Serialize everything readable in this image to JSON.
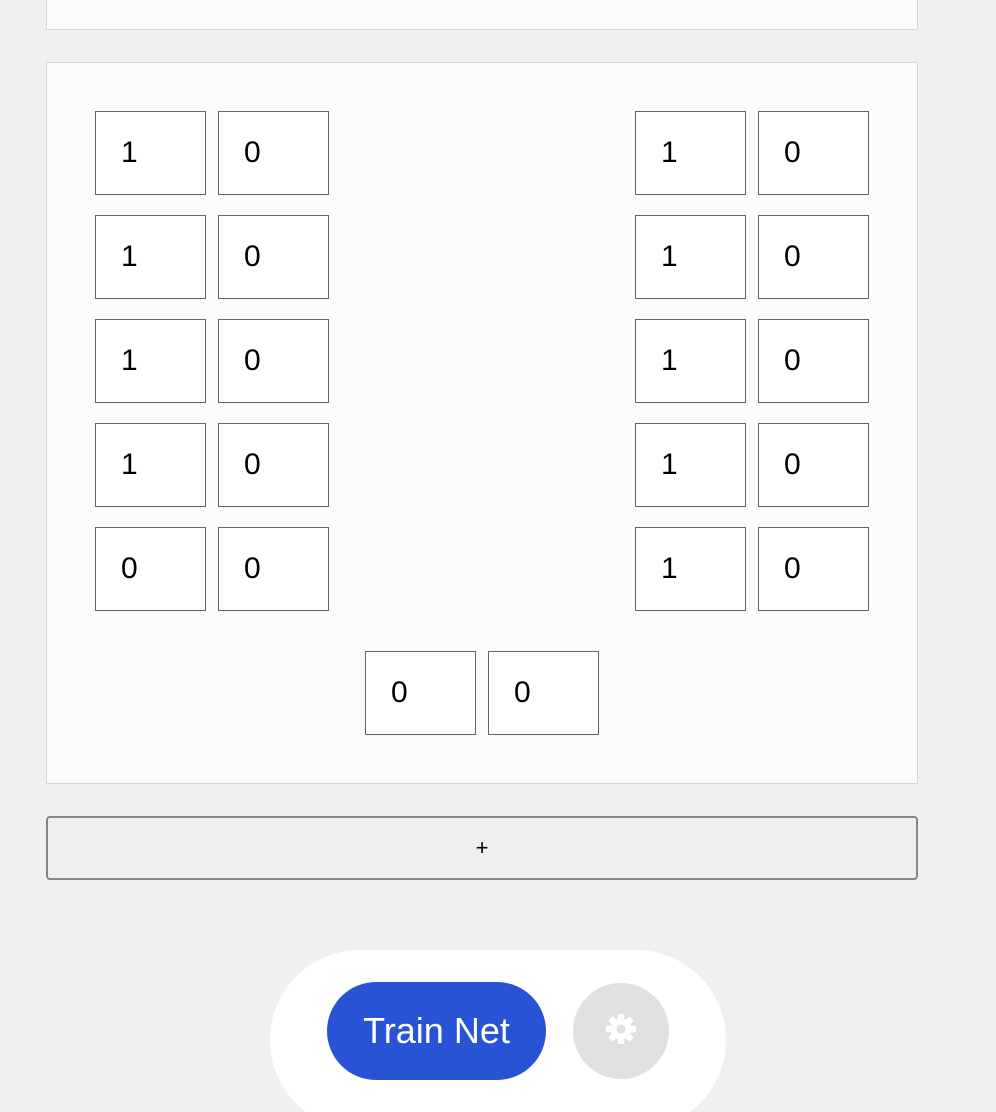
{
  "grid": {
    "left_column": [
      [
        "1",
        "0"
      ],
      [
        "1",
        "0"
      ],
      [
        "1",
        "0"
      ],
      [
        "1",
        "0"
      ],
      [
        "0",
        "0"
      ]
    ],
    "right_column": [
      [
        "1",
        "0"
      ],
      [
        "1",
        "0"
      ],
      [
        "1",
        "0"
      ],
      [
        "1",
        "0"
      ],
      [
        "1",
        "0"
      ]
    ],
    "bottom_pair": [
      "0",
      "0"
    ]
  },
  "add_button": {
    "label": "+"
  },
  "actions": {
    "train_label": "Train Net",
    "settings_icon": "gear-icon"
  },
  "colors": {
    "accent": "#2753d4",
    "settings_bg": "#e0e0e0",
    "page_bg": "#f0f0f0"
  }
}
